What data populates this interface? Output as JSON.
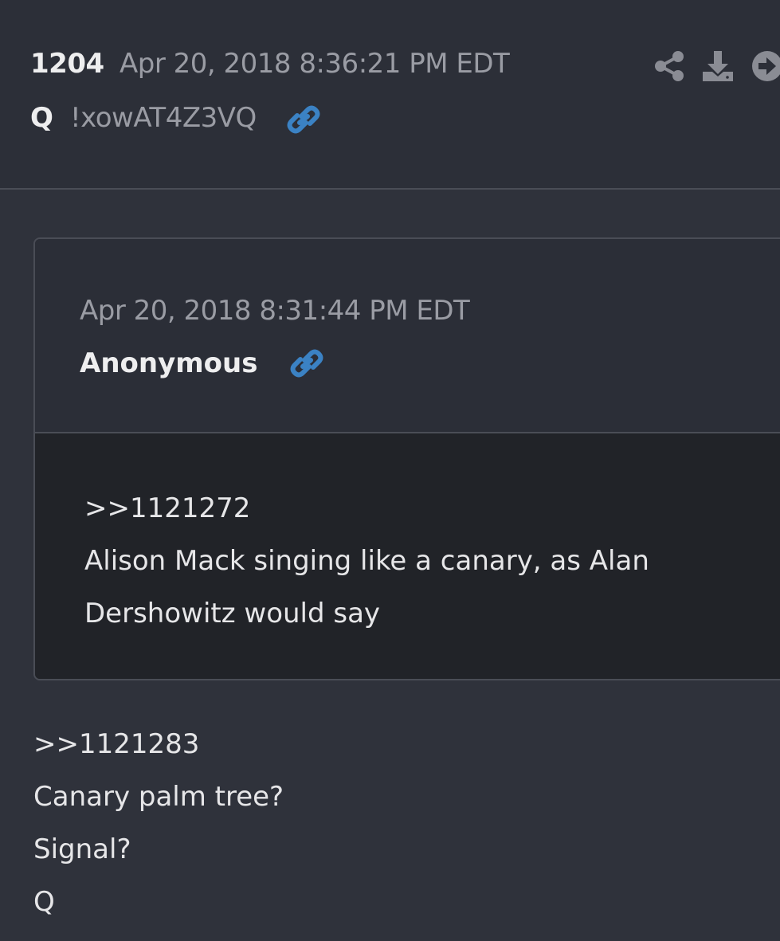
{
  "post": {
    "number": "1204",
    "date": "Apr 20, 2018 8:36:21 PM EDT",
    "author": "Q",
    "tripcode": "!xowAT4Z3VQ",
    "icons": {
      "link": "link-icon",
      "share": "share-icon",
      "download": "download-icon",
      "open": "arrow-circle-right-icon"
    }
  },
  "quoted_post": {
    "date": "Apr 20, 2018 8:31:44 PM EDT",
    "author": "Anonymous",
    "lines": [
      ">>1121272",
      "Alison Mack singing like a canary, as Alan",
      "Dershowitz would say"
    ]
  },
  "body": {
    "lines": [
      ">>1121283",
      "Canary palm tree?",
      "Signal?",
      "Q"
    ]
  },
  "colors": {
    "background": "#2f323b",
    "card_body": "#212328",
    "link_blue": "#3b82c4",
    "muted_text": "#9a9ca4"
  }
}
